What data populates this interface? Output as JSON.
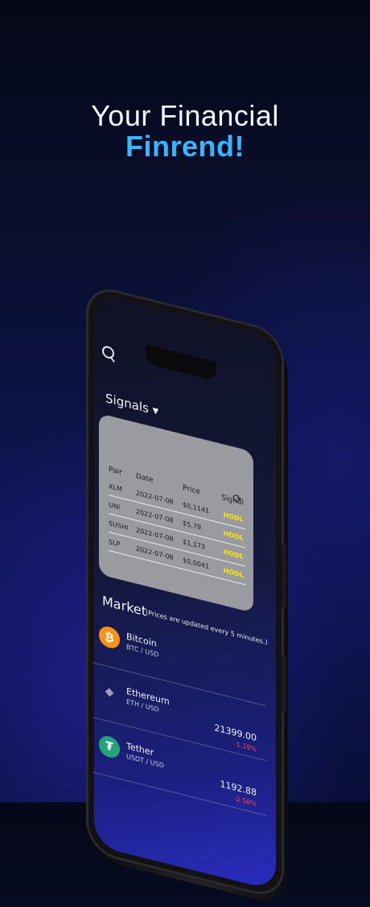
{
  "headline": {
    "line1": "Your Financial",
    "line2": "Finrend!"
  },
  "phone": {
    "signals": {
      "title": "Signals ▾",
      "columns": [
        "Pair",
        "Date",
        "Price",
        "Signal"
      ],
      "rows": [
        {
          "pair": "XLM",
          "date": "2022-07-08",
          "price": "$0,1141",
          "signal": "HODL"
        },
        {
          "pair": "UNI",
          "date": "2022-07-08",
          "price": "$5,79",
          "signal": "HODL"
        },
        {
          "pair": "SUSHI",
          "date": "2022-07-08",
          "price": "$1,173",
          "signal": "HODL"
        },
        {
          "pair": "SLP",
          "date": "2022-07-08",
          "price": "$0,0041",
          "signal": "HODL"
        }
      ]
    },
    "market": {
      "title": "Market",
      "note": "(Prices are updated every 5 minutes.)",
      "coins": [
        {
          "name": "Bitcoin",
          "pair": "BTC / USD",
          "price": "",
          "change": "",
          "icon": "bitcoin-icon",
          "glyph": "₿",
          "color": "#f7931a"
        },
        {
          "name": "Ethereum",
          "pair": "ETH / USD",
          "price": "21399.00",
          "change": "-1.19%",
          "icon": "ethereum-icon",
          "glyph": "◆",
          "color": "#6b6f8a"
        },
        {
          "name": "Tether",
          "pair": "USDT / USD",
          "price": "1192.88",
          "change": "-2.58%",
          "icon": "tether-icon",
          "glyph": "₮",
          "color": "#26a17b"
        }
      ]
    }
  }
}
